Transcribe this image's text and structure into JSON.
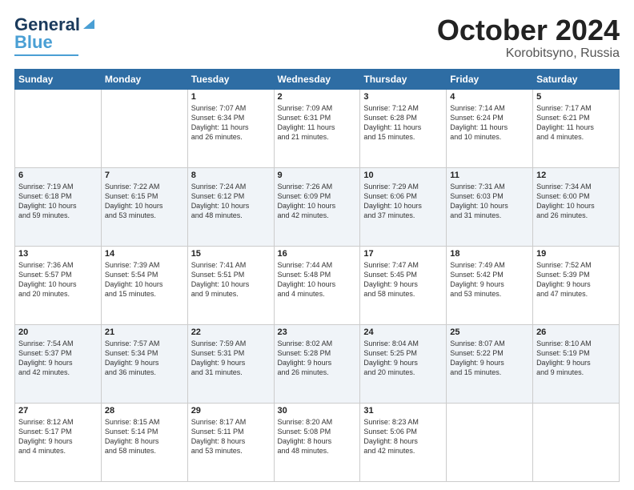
{
  "header": {
    "logo_line1": "General",
    "logo_line2": "Blue",
    "month": "October 2024",
    "location": "Korobitsyno, Russia"
  },
  "weekdays": [
    "Sunday",
    "Monday",
    "Tuesday",
    "Wednesday",
    "Thursday",
    "Friday",
    "Saturday"
  ],
  "weeks": [
    [
      {
        "day": "",
        "info": ""
      },
      {
        "day": "",
        "info": ""
      },
      {
        "day": "1",
        "info": "Sunrise: 7:07 AM\nSunset: 6:34 PM\nDaylight: 11 hours\nand 26 minutes."
      },
      {
        "day": "2",
        "info": "Sunrise: 7:09 AM\nSunset: 6:31 PM\nDaylight: 11 hours\nand 21 minutes."
      },
      {
        "day": "3",
        "info": "Sunrise: 7:12 AM\nSunset: 6:28 PM\nDaylight: 11 hours\nand 15 minutes."
      },
      {
        "day": "4",
        "info": "Sunrise: 7:14 AM\nSunset: 6:24 PM\nDaylight: 11 hours\nand 10 minutes."
      },
      {
        "day": "5",
        "info": "Sunrise: 7:17 AM\nSunset: 6:21 PM\nDaylight: 11 hours\nand 4 minutes."
      }
    ],
    [
      {
        "day": "6",
        "info": "Sunrise: 7:19 AM\nSunset: 6:18 PM\nDaylight: 10 hours\nand 59 minutes."
      },
      {
        "day": "7",
        "info": "Sunrise: 7:22 AM\nSunset: 6:15 PM\nDaylight: 10 hours\nand 53 minutes."
      },
      {
        "day": "8",
        "info": "Sunrise: 7:24 AM\nSunset: 6:12 PM\nDaylight: 10 hours\nand 48 minutes."
      },
      {
        "day": "9",
        "info": "Sunrise: 7:26 AM\nSunset: 6:09 PM\nDaylight: 10 hours\nand 42 minutes."
      },
      {
        "day": "10",
        "info": "Sunrise: 7:29 AM\nSunset: 6:06 PM\nDaylight: 10 hours\nand 37 minutes."
      },
      {
        "day": "11",
        "info": "Sunrise: 7:31 AM\nSunset: 6:03 PM\nDaylight: 10 hours\nand 31 minutes."
      },
      {
        "day": "12",
        "info": "Sunrise: 7:34 AM\nSunset: 6:00 PM\nDaylight: 10 hours\nand 26 minutes."
      }
    ],
    [
      {
        "day": "13",
        "info": "Sunrise: 7:36 AM\nSunset: 5:57 PM\nDaylight: 10 hours\nand 20 minutes."
      },
      {
        "day": "14",
        "info": "Sunrise: 7:39 AM\nSunset: 5:54 PM\nDaylight: 10 hours\nand 15 minutes."
      },
      {
        "day": "15",
        "info": "Sunrise: 7:41 AM\nSunset: 5:51 PM\nDaylight: 10 hours\nand 9 minutes."
      },
      {
        "day": "16",
        "info": "Sunrise: 7:44 AM\nSunset: 5:48 PM\nDaylight: 10 hours\nand 4 minutes."
      },
      {
        "day": "17",
        "info": "Sunrise: 7:47 AM\nSunset: 5:45 PM\nDaylight: 9 hours\nand 58 minutes."
      },
      {
        "day": "18",
        "info": "Sunrise: 7:49 AM\nSunset: 5:42 PM\nDaylight: 9 hours\nand 53 minutes."
      },
      {
        "day": "19",
        "info": "Sunrise: 7:52 AM\nSunset: 5:39 PM\nDaylight: 9 hours\nand 47 minutes."
      }
    ],
    [
      {
        "day": "20",
        "info": "Sunrise: 7:54 AM\nSunset: 5:37 PM\nDaylight: 9 hours\nand 42 minutes."
      },
      {
        "day": "21",
        "info": "Sunrise: 7:57 AM\nSunset: 5:34 PM\nDaylight: 9 hours\nand 36 minutes."
      },
      {
        "day": "22",
        "info": "Sunrise: 7:59 AM\nSunset: 5:31 PM\nDaylight: 9 hours\nand 31 minutes."
      },
      {
        "day": "23",
        "info": "Sunrise: 8:02 AM\nSunset: 5:28 PM\nDaylight: 9 hours\nand 26 minutes."
      },
      {
        "day": "24",
        "info": "Sunrise: 8:04 AM\nSunset: 5:25 PM\nDaylight: 9 hours\nand 20 minutes."
      },
      {
        "day": "25",
        "info": "Sunrise: 8:07 AM\nSunset: 5:22 PM\nDaylight: 9 hours\nand 15 minutes."
      },
      {
        "day": "26",
        "info": "Sunrise: 8:10 AM\nSunset: 5:19 PM\nDaylight: 9 hours\nand 9 minutes."
      }
    ],
    [
      {
        "day": "27",
        "info": "Sunrise: 8:12 AM\nSunset: 5:17 PM\nDaylight: 9 hours\nand 4 minutes."
      },
      {
        "day": "28",
        "info": "Sunrise: 8:15 AM\nSunset: 5:14 PM\nDaylight: 8 hours\nand 58 minutes."
      },
      {
        "day": "29",
        "info": "Sunrise: 8:17 AM\nSunset: 5:11 PM\nDaylight: 8 hours\nand 53 minutes."
      },
      {
        "day": "30",
        "info": "Sunrise: 8:20 AM\nSunset: 5:08 PM\nDaylight: 8 hours\nand 48 minutes."
      },
      {
        "day": "31",
        "info": "Sunrise: 8:23 AM\nSunset: 5:06 PM\nDaylight: 8 hours\nand 42 minutes."
      },
      {
        "day": "",
        "info": ""
      },
      {
        "day": "",
        "info": ""
      }
    ]
  ]
}
